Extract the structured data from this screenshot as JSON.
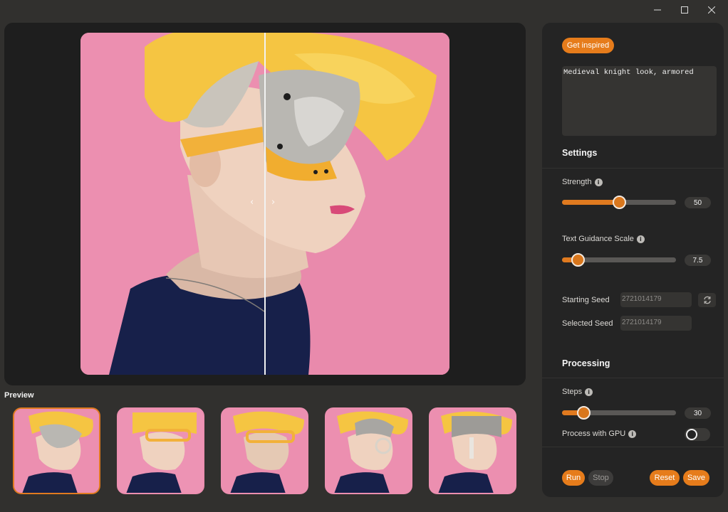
{
  "window": {
    "minimize_icon": "minimize-icon",
    "maximize_icon": "maximize-icon",
    "close_icon": "close-icon"
  },
  "viewer": {
    "prev_arrow": "‹",
    "next_arrow": "›",
    "split_icon_left": "chevron-left-icon",
    "split_icon_right": "chevron-right-icon"
  },
  "preview": {
    "title": "Preview",
    "selected_index": 0,
    "count": 5
  },
  "panel": {
    "get_inspired_label": "Get inspired",
    "prompt_text": "Medieval knight look, armored",
    "settings_title": "Settings",
    "strength": {
      "label": "Strength",
      "value": "50",
      "fraction": 0.5
    },
    "guidance": {
      "label": "Text Guidance Scale",
      "value": "7.5",
      "fraction": 0.14
    },
    "starting_seed": {
      "label": "Starting Seed",
      "value": "2721014179"
    },
    "selected_seed": {
      "label": "Selected Seed",
      "value": "2721014179"
    },
    "processing_title": "Processing",
    "steps": {
      "label": "Steps",
      "value": "30",
      "fraction": 0.19
    },
    "gpu": {
      "label": "Process with GPU",
      "enabled": false
    },
    "run_label": "Run",
    "stop_label": "Stop",
    "reset_label": "Reset",
    "save_label": "Save"
  },
  "colors": {
    "accent": "#e67c1b",
    "background": "#31302e",
    "panel": "#242424",
    "pink_backdrop": "#ec8fb0",
    "hair_yellow": "#f5c542"
  }
}
